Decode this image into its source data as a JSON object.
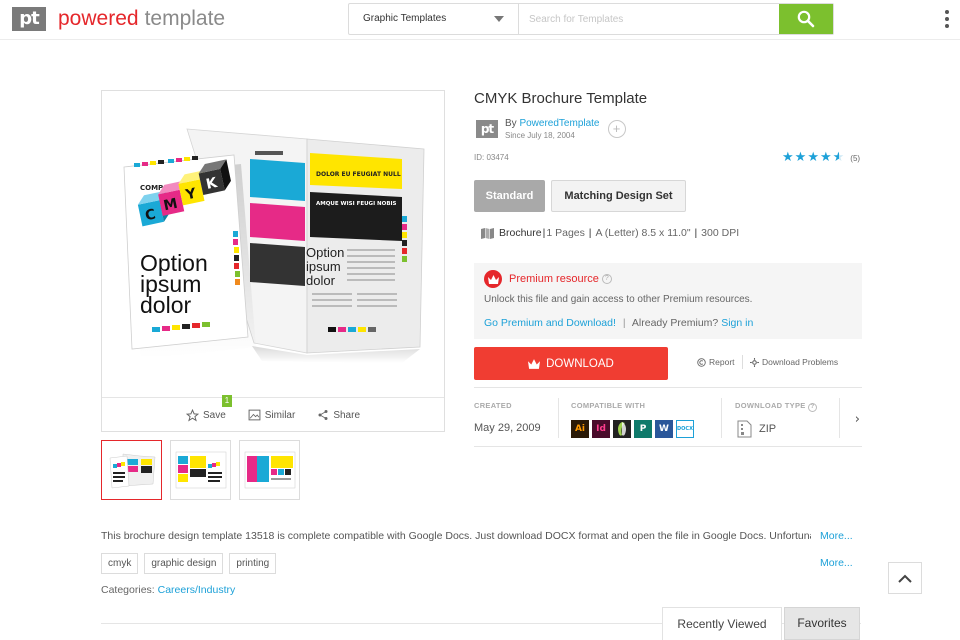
{
  "header": {
    "logo_mark": "pt",
    "logo_word1": "powered",
    "logo_word2": "template",
    "category_selected": "Graphic Templates",
    "search_placeholder": "Search for Templates"
  },
  "colors": {
    "brand_red": "#e5272b",
    "download_red": "#f03d32",
    "search_green": "#7cc02e",
    "link_blue": "#1da1d8"
  },
  "preview": {
    "cover_company": "COMPANY",
    "cover_headline": [
      "Option",
      "ipsum",
      "dolor"
    ],
    "cube_letters": [
      "C",
      "M",
      "Y",
      "K"
    ],
    "inner_headlines": [
      "DOLOR EU FEUGIAT NULL",
      "AMQUE WISI FEUGI NOBIS"
    ],
    "inner_option": [
      "Option",
      "ipsum",
      "dolor"
    ],
    "actions": {
      "save": "Save",
      "save_count": "1",
      "similar": "Similar",
      "share": "Share"
    }
  },
  "product": {
    "title": "CMYK Brochure Template",
    "by": "By",
    "author": "PoweredTemplate",
    "since": "Since July 18, 2004",
    "id": "ID: 03474",
    "rating": 4.5,
    "rating_count": "(5)",
    "tab_standard": "Standard",
    "tab_matching": "Matching Design Set",
    "spec_type": "Brochure",
    "spec_pages": "1 Pages",
    "spec_size": "A (Letter) 8.5 x 11.0\"",
    "spec_dpi": "300 DPI"
  },
  "premium": {
    "title": "Premium resource",
    "text": "Unlock this file and gain access to other Premium resources.",
    "go_premium": "Go Premium and Download!",
    "already": "Already Premium?",
    "sign_in": "Sign in"
  },
  "download": {
    "label": "DOWNLOAD",
    "report": "Report",
    "problems": "Download Problems"
  },
  "meta": {
    "created_label": "CREATED",
    "created_value": "May 29, 2009",
    "compat_label": "COMPATIBLE WITH",
    "apps": [
      {
        "name": "Illustrator",
        "abbr": "Ai",
        "bg": "#2b1a06",
        "fg": "#ff9a00"
      },
      {
        "name": "InDesign",
        "abbr": "Id",
        "bg": "#4a0b2b",
        "fg": "#ff3d8e"
      },
      {
        "name": "CorelDRAW",
        "abbr": "C",
        "bg": "#222222",
        "fg": "#9fd24f"
      },
      {
        "name": "Publisher",
        "abbr": "P",
        "bg": "#0f7a6b",
        "fg": "#ffffff"
      },
      {
        "name": "Word",
        "abbr": "W",
        "bg": "#2b579a",
        "fg": "#ffffff"
      },
      {
        "name": "Docs",
        "abbr": "DOCX",
        "bg": "#ffffff",
        "fg": "#1da1d8"
      }
    ],
    "dltype_label": "DOWNLOAD TYPE",
    "dltype_value": "ZIP"
  },
  "description": {
    "text": "This brochure design template 13518 is complete compatible with Google Docs. Just download DOCX format and open the file in Google Docs. Unfortunately",
    "more": "More...",
    "more2": "More..."
  },
  "tags": [
    "cmyk",
    "graphic design",
    "printing"
  ],
  "categories": {
    "label": "Categories:",
    "value": "Careers/Industry"
  },
  "bottom_tabs": {
    "recent": "Recently Viewed",
    "favorites": "Favorites"
  }
}
